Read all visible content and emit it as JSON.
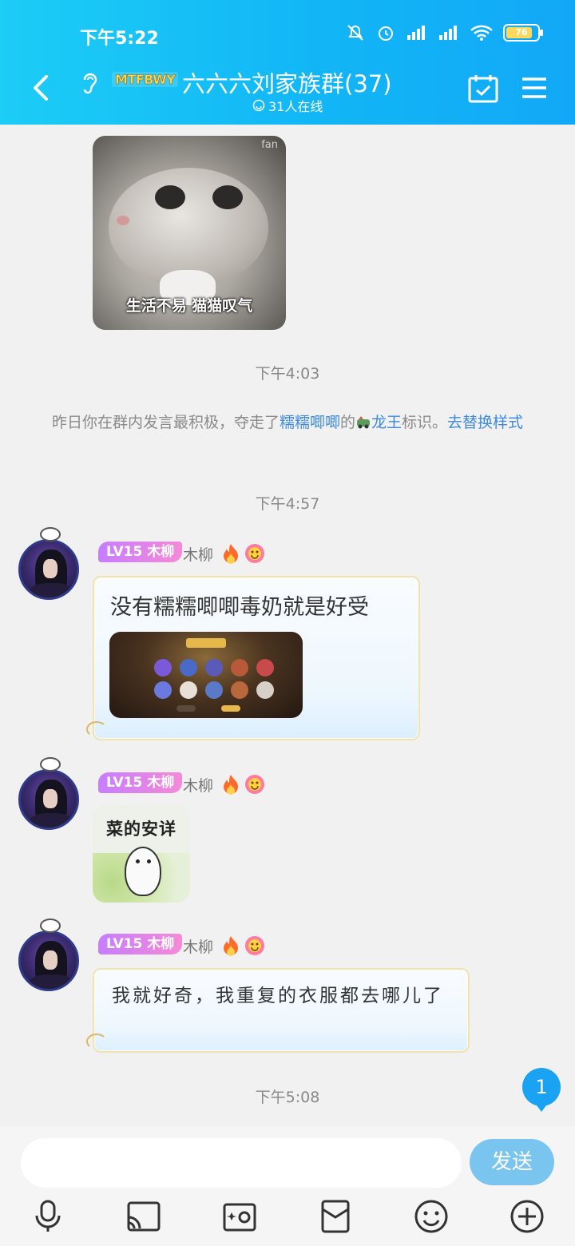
{
  "status": {
    "time": "下午5:22",
    "battery": "76"
  },
  "header": {
    "brand_badge": "MTFBWY",
    "title": "六六六刘家族群(37)",
    "online": "31人在线"
  },
  "messages": {
    "cat_sticker": {
      "watermark": "fan",
      "caption": "生活不易 猫猫叹气"
    },
    "time_1": "下午4:03",
    "system": {
      "prefix": "昨日你在群内发言最积极，夺走了",
      "user_link": "糯糯唧唧",
      "middle": "的",
      "title_link": "龙王",
      "suffix": "标识。",
      "action_link": "去替换样式"
    },
    "time_2": "下午4:57",
    "sender": {
      "level": "LV15 木柳",
      "name": "木柳"
    },
    "msg1_text": "没有糯糯唧唧毒奶就是好受",
    "penguin_sticker": {
      "label": "菜的安详"
    },
    "msg3_text": "我就好奇，我重复的衣服都去哪儿了",
    "time_3": "下午5:08"
  },
  "unread_count": "1",
  "input": {
    "placeholder": "",
    "send_label": "发送"
  },
  "toolbar": [
    "microphone-icon",
    "cast-screen-icon",
    "photo-icon",
    "red-packet-icon",
    "emoji-icon",
    "plus-icon"
  ],
  "colors": {
    "header_gradient_start": "#1ccdf6",
    "header_gradient_end": "#12a8f7",
    "link": "#3c8ae0",
    "send_button": "#7ac4f0",
    "badge": "#1aa3f3"
  }
}
